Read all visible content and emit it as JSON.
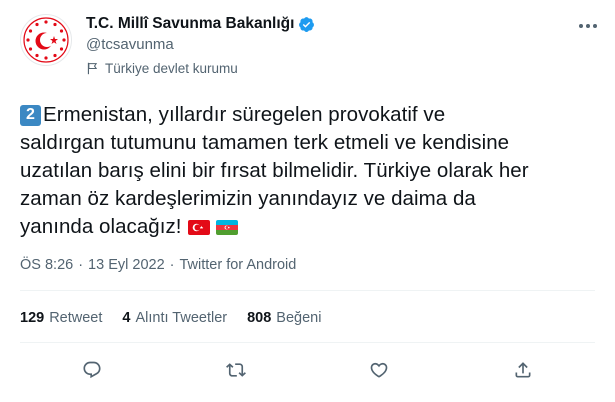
{
  "account": {
    "display_name": "T.C. Millî Savunma Bakanlığı",
    "handle": "@tcsavunma",
    "label": "Türkiye devlet kurumu"
  },
  "tweet": {
    "keycap": "2",
    "lines": [
      "Ermenistan, yıllardır süregelen provokatif ve",
      "saldırgan tutumunu tamamen terk etmeli ve kendisine",
      "uzatılan barış elini bir fırsat bilmelidir. Türkiye olarak her",
      "zaman öz kardeşlerimizin yanındayız ve daima da",
      "yanında olacağız!"
    ]
  },
  "meta": {
    "time": "ÖS 8:26",
    "separator": "·",
    "date": "13 Eyl 2022",
    "source": "Twitter for Android"
  },
  "stats": {
    "retweets": {
      "count": "129",
      "label": "Retweet"
    },
    "quotes": {
      "count": "4",
      "label": "Alıntı Tweetler"
    },
    "likes": {
      "count": "808",
      "label": "Beğeni"
    }
  },
  "icons": [
    "ministry-logo-icon",
    "verified-badge-icon",
    "government-flag-icon",
    "more-options-icon",
    "turkey-flag-icon",
    "azerbaijan-flag-icon",
    "reply-icon",
    "retweet-icon",
    "like-icon",
    "share-icon"
  ],
  "colors": {
    "text": "#0f1419",
    "secondary_text": "#536471",
    "verified_blue": "#1d9bf0",
    "logo_red": "#e30a17",
    "keycap_blue": "#3b88c3"
  }
}
